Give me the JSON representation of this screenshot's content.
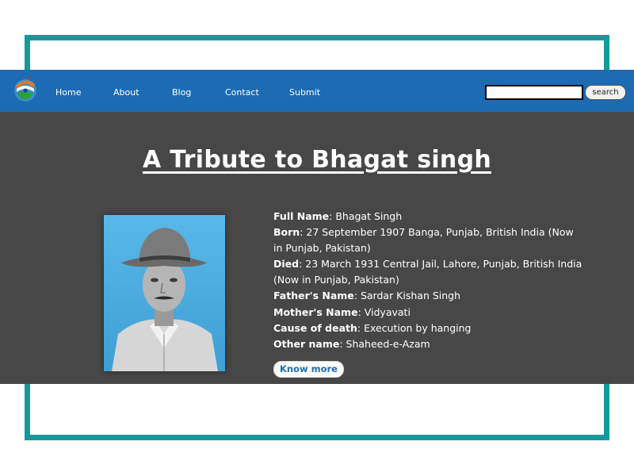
{
  "nav": {
    "logo_icon": "flag-globe-logo-icon",
    "links": [
      "Home",
      "About",
      "Blog",
      "Contact",
      "Submit"
    ],
    "search_value": "",
    "search_button": "search",
    "bg": "#1c6bb3"
  },
  "main": {
    "title": "A Tribute to Bhagat singh",
    "bg": "#474747",
    "details": [
      {
        "key": "Full Name",
        "value": ": Bhagat Singh"
      },
      {
        "key": "Born",
        "value": ": 27 September 1907 Banga, Punjab, British India (Now in Punjab, Pakistan)"
      },
      {
        "key": "Died",
        "value": ": 23 March 1931 Central Jail, Lahore, Punjab, British India (Now in Punjab, Pakistan)"
      },
      {
        "key": "Father's Name",
        "value": ": Sardar Kishan Singh"
      },
      {
        "key": "Mother's Name",
        "value": ": Vidyavati"
      },
      {
        "key": "Cause of death",
        "value": ": Execution by hanging"
      },
      {
        "key": "Other name",
        "value": ": Shaheed-e-Azam"
      }
    ],
    "know_more": "Know more"
  },
  "colors": {
    "frame": "#17999b",
    "accent": "#1c6bb3"
  }
}
